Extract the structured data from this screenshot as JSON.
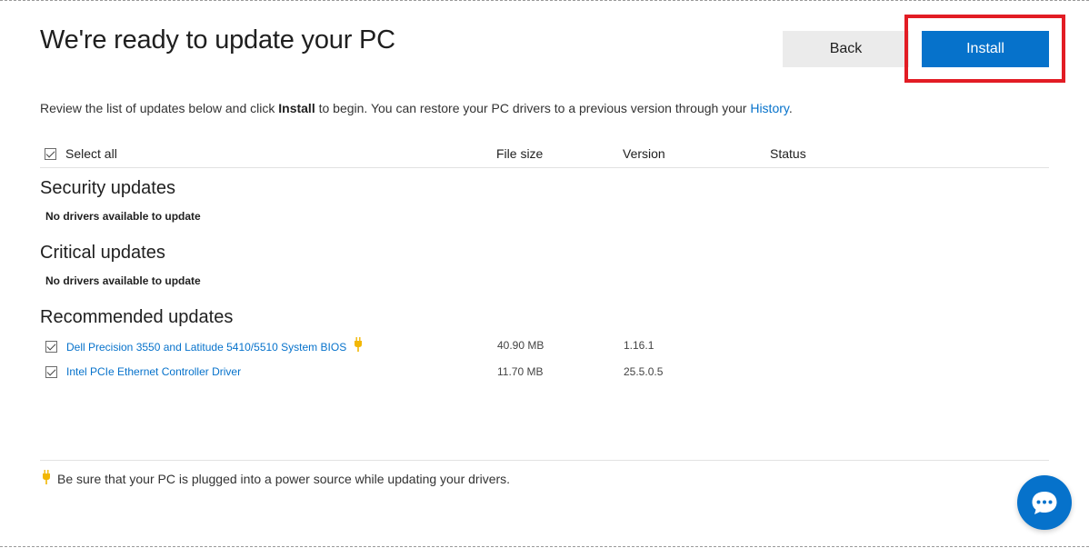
{
  "header": {
    "title": "We're ready to update your PC",
    "back_label": "Back",
    "install_label": "Install"
  },
  "intro": {
    "before": "Review the list of updates below and click ",
    "bold": "Install",
    "middle": " to begin. You can restore your PC drivers to a previous version through your ",
    "link": "History",
    "after": "."
  },
  "table_header": {
    "select_all": "Select all",
    "file_size": "File size",
    "version": "Version",
    "status": "Status"
  },
  "sections": {
    "security": {
      "title": "Security updates",
      "message": "No drivers available to update"
    },
    "critical": {
      "title": "Critical updates",
      "message": "No drivers available to update"
    },
    "recommended": {
      "title": "Recommended updates",
      "items": [
        {
          "name": "Dell Precision 3550 and Latitude 5410/5510 System BIOS",
          "size": "40.90 MB",
          "version": "1.16.1",
          "checked": true,
          "power_required_icon": "plug-icon"
        },
        {
          "name": "Intel PCIe Ethernet Controller Driver",
          "size": "11.70 MB",
          "version": "25.5.0.5",
          "checked": true
        }
      ]
    }
  },
  "footer": {
    "note": "Be sure that your PC is plugged into a power source while updating your drivers.",
    "icon": "plug-icon"
  },
  "chat": {
    "icon": "chat-bubble-icon"
  },
  "colors": {
    "accent": "#0672cb",
    "highlight": "#e21c24",
    "plug": "#f2b705"
  }
}
